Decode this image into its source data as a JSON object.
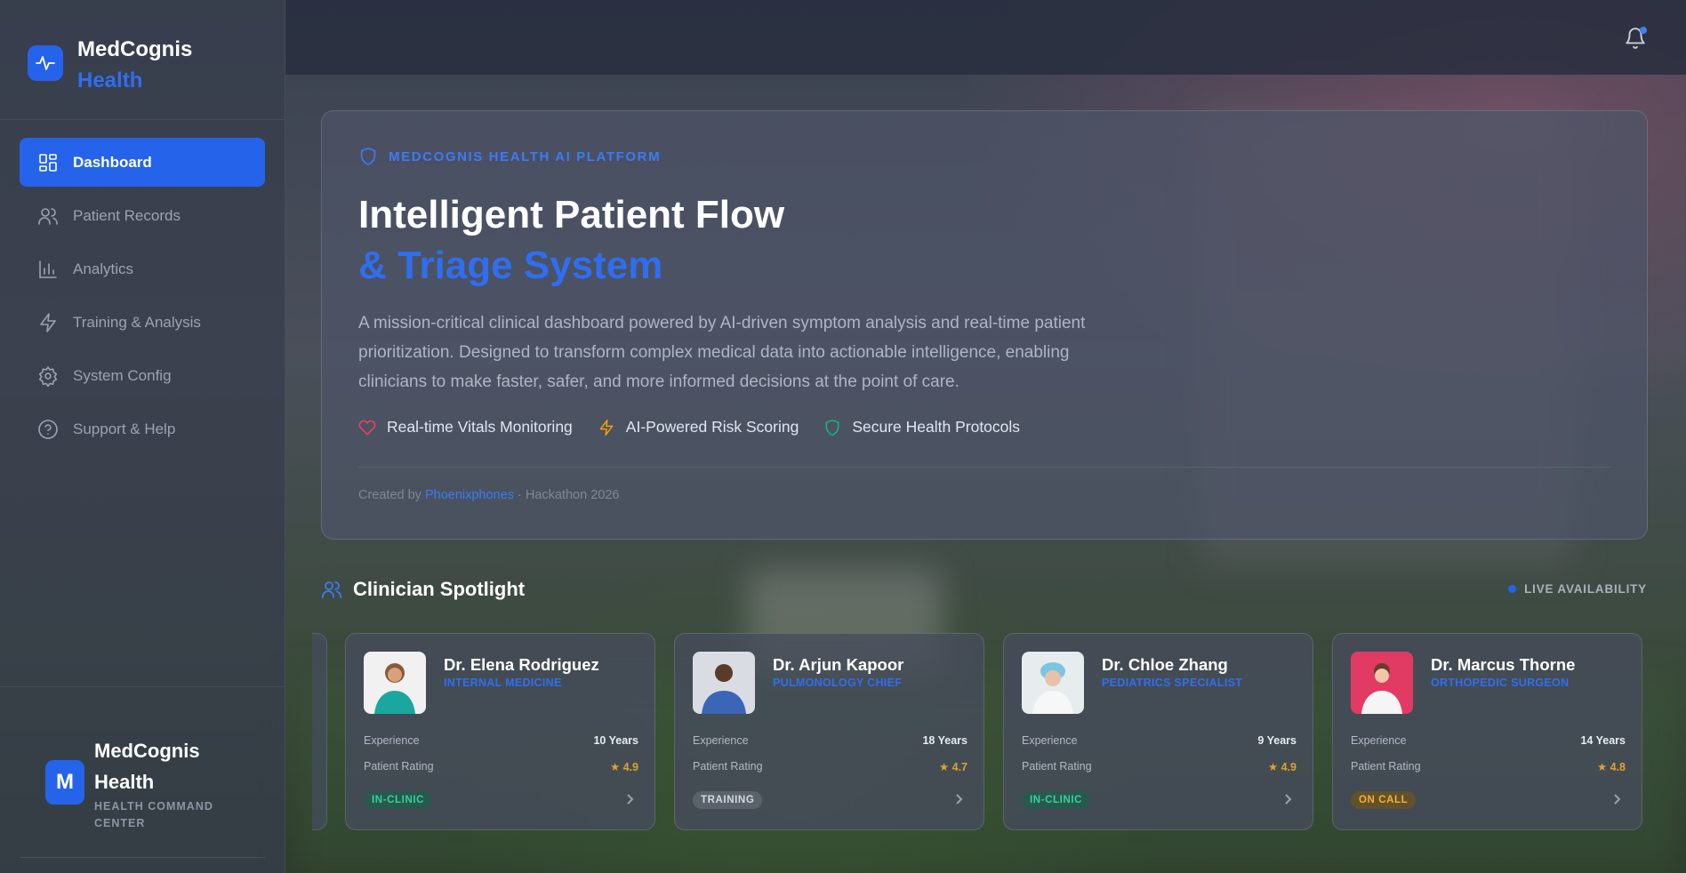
{
  "brand": {
    "name": "MedCognis",
    "accent": "Health"
  },
  "sidebar": {
    "items": [
      {
        "label": "Dashboard",
        "icon": "dashboard-icon",
        "active": true
      },
      {
        "label": "Patient Records",
        "icon": "users-icon",
        "active": false
      },
      {
        "label": "Analytics",
        "icon": "bar-chart-icon",
        "active": false
      },
      {
        "label": "Training & Analysis",
        "icon": "lightning-icon",
        "active": false
      },
      {
        "label": "System Config",
        "icon": "gear-icon",
        "active": false
      },
      {
        "label": "Support & Help",
        "icon": "help-circle-icon",
        "active": false
      }
    ],
    "footer": {
      "avatar_letter": "M",
      "name": "MedCognis Health",
      "subtitle": "HEALTH COMMAND CENTER"
    }
  },
  "topbar": {
    "notification_icon": "bell-icon",
    "has_unread": true
  },
  "hero": {
    "eyebrow": "MEDCOGNIS HEALTH AI PLATFORM",
    "title_line1": "Intelligent Patient Flow",
    "title_line2": "& Triage System",
    "description": "A mission-critical clinical dashboard powered by AI-driven symptom analysis and real-time patient prioritization. Designed to transform complex medical data into actionable intelligence, enabling clinicians to make faster, safer, and more informed decisions at the point of care.",
    "features": [
      {
        "label": "Real-time Vitals Monitoring",
        "icon": "heart-icon",
        "color": "#f43f5e"
      },
      {
        "label": "AI-Powered Risk Scoring",
        "icon": "lightning-icon",
        "color": "#f59e0b"
      },
      {
        "label": "Secure Health Protocols",
        "icon": "shield-icon",
        "color": "#10b981"
      }
    ],
    "credit_prefix": "Created by",
    "credit_link": "Phoenixphones",
    "credit_suffix": "· Hackathon 2026"
  },
  "spotlight": {
    "title": "Clinician Spotlight",
    "live_label": "LIVE AVAILABILITY",
    "experience_label": "Experience",
    "rating_label": "Patient Rating",
    "clinicians": [
      {
        "name": "Dr. Elena Rodriguez",
        "role": "INTERNAL MEDICINE",
        "experience": "10 Years",
        "rating": "★ 4.9",
        "status": "IN-CLINIC",
        "status_color": "#34d399"
      },
      {
        "name": "Dr. Arjun Kapoor",
        "role": "PULMONOLOGY CHIEF",
        "experience": "18 Years",
        "rating": "★ 4.7",
        "status": "TRAINING",
        "status_color": "#d5d9e1"
      },
      {
        "name": "Dr. Chloe Zhang",
        "role": "PEDIATRICS SPECIALIST",
        "experience": "9 Years",
        "rating": "★ 4.9",
        "status": "IN-CLINIC",
        "status_color": "#34d399"
      },
      {
        "name": "Dr. Marcus Thorne",
        "role": "ORTHOPEDIC SURGEON",
        "experience": "14 Years",
        "rating": "★ 4.8",
        "status": "ON CALL",
        "status_color": "#f5b32d"
      }
    ]
  },
  "colors": {
    "accent": "#2563eb",
    "accent_text": "#2f6ef0"
  }
}
